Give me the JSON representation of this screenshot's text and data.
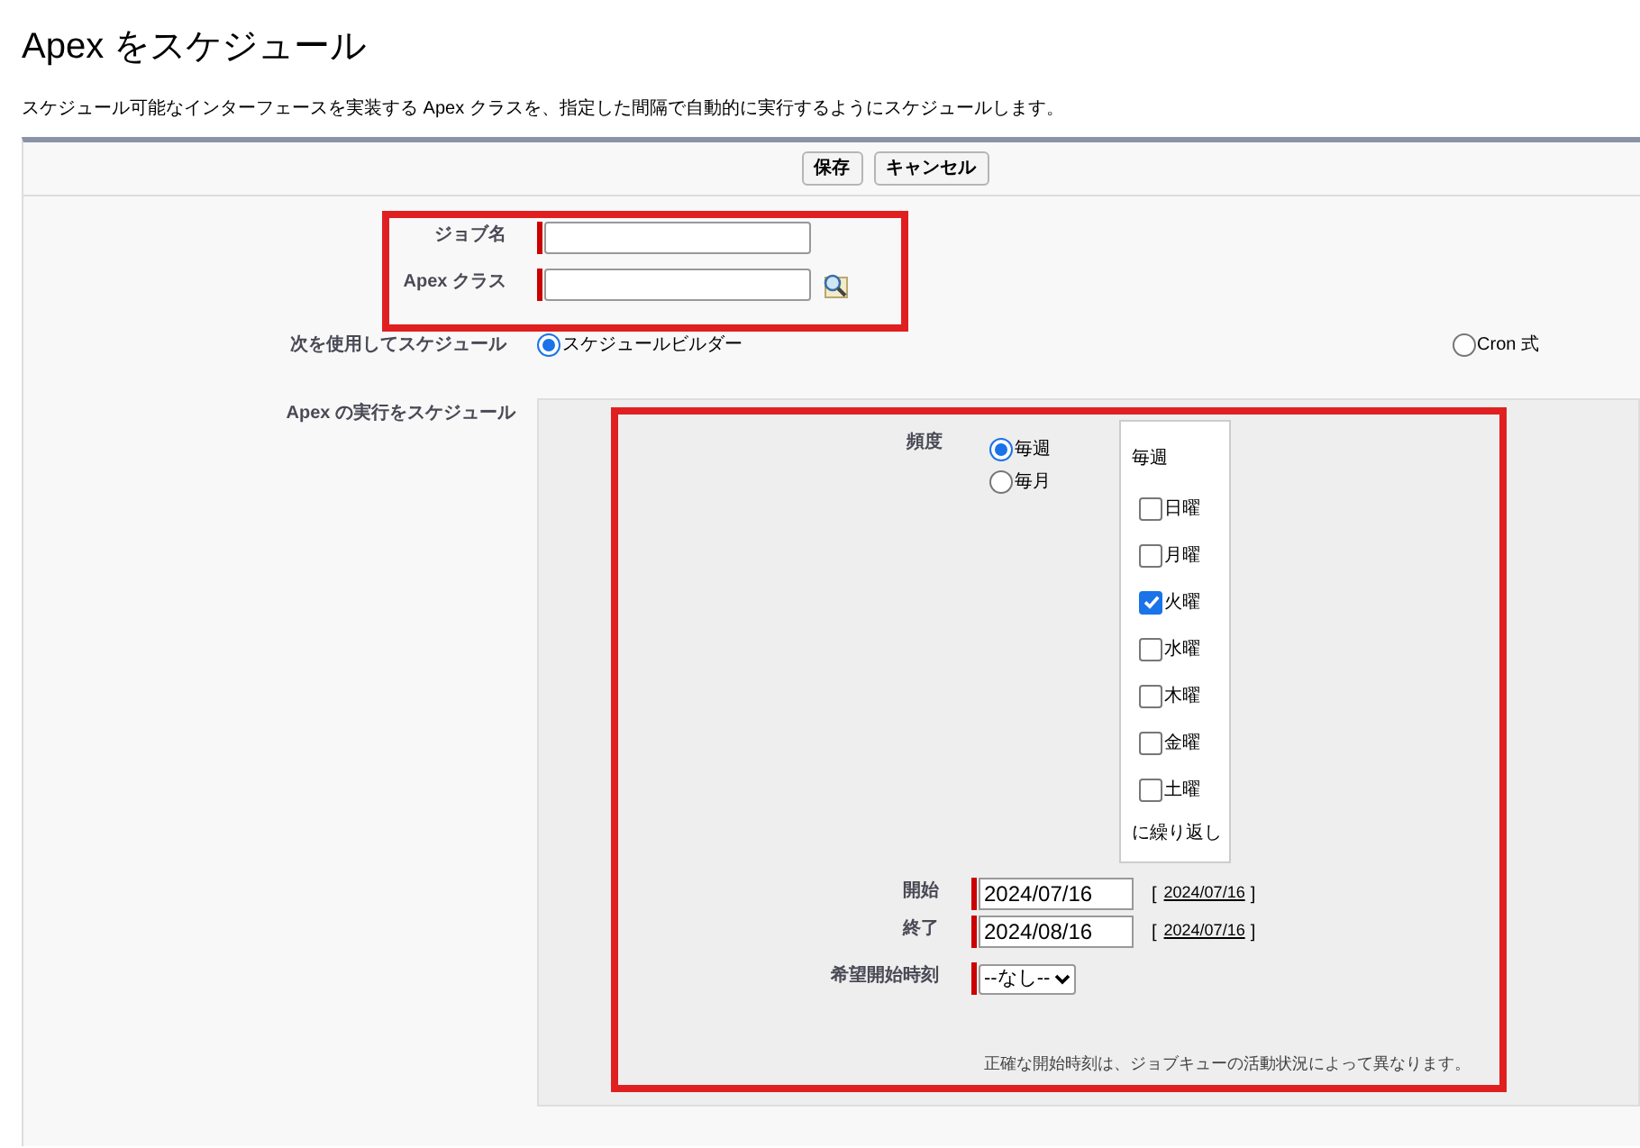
{
  "title": "Apex をスケジュール",
  "description": "スケジュール可能なインターフェースを実装する Apex クラスを、指定した間隔で自動的に実行するようにスケジュールします。",
  "buttons": [
    {
      "label": "保存"
    },
    {
      "label": "キャンセル"
    }
  ],
  "fields": [
    {
      "label": "ジョブ名",
      "required": true,
      "lookup": false
    },
    {
      "label": "Apex クラス",
      "required": true,
      "lookup": true
    }
  ],
  "schedule_using": {
    "label": "次を使用してスケジュール",
    "options": [
      {
        "label": "スケジュールビルダー",
        "selected": true
      },
      {
        "label": "Cron 式",
        "selected": false
      }
    ]
  },
  "execution": {
    "label": "Apex の実行をスケジュール",
    "frequency": {
      "label": "頻度",
      "options": [
        {
          "label": "毎週",
          "selected": true
        },
        {
          "label": "毎月",
          "selected": false
        }
      ]
    },
    "weekly": {
      "heading": "毎週",
      "footer": "に繰り返し",
      "days": [
        {
          "label": "日曜",
          "checked": false
        },
        {
          "label": "月曜",
          "checked": false
        },
        {
          "label": "火曜",
          "checked": true
        },
        {
          "label": "水曜",
          "checked": false
        },
        {
          "label": "木曜",
          "checked": false
        },
        {
          "label": "金曜",
          "checked": false
        },
        {
          "label": "土曜",
          "checked": false
        }
      ]
    },
    "dates": [
      {
        "label": "開始",
        "value": "2024/07/16",
        "open": "[",
        "link": "2024/07/16",
        "close": "]"
      },
      {
        "label": "終了",
        "value": "2024/08/16",
        "open": "[",
        "link": "2024/07/16",
        "close": "]"
      }
    ],
    "preferred_time": {
      "label": "希望開始時刻",
      "value": "--なし--"
    },
    "note": "正確な開始時刻は、ジョブキューの活動状況によって異なります。"
  }
}
